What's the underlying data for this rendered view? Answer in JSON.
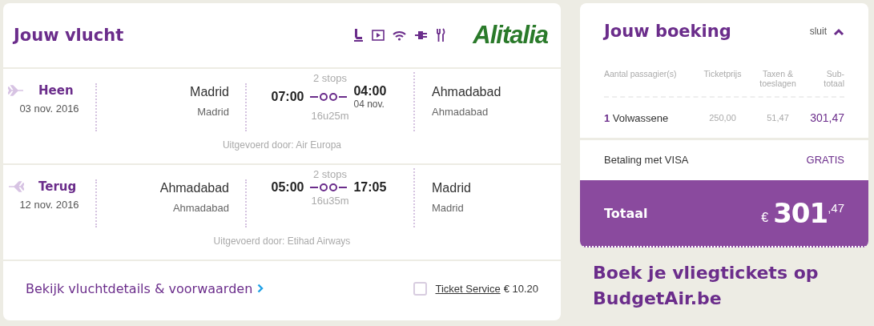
{
  "flight": {
    "title": "Jouw vlucht",
    "airline_logo": "Alitalia",
    "legs": [
      {
        "kind": "outbound",
        "label": "Heen",
        "date": "03 nov. 2016",
        "from_city": "Madrid",
        "from_airport": "Madrid",
        "depart": "07:00",
        "stops": "2 stops",
        "duration": "16u25m",
        "arrive": "04:00",
        "arrive_date": "04 nov.",
        "to_city": "Ahmadabad",
        "to_airport": "Ahmadabad",
        "operated_by": "Uitgevoerd door: Air Europa"
      },
      {
        "kind": "return",
        "label": "Terug",
        "date": "12 nov. 2016",
        "from_city": "Ahmadabad",
        "from_airport": "Ahmadabad",
        "depart": "05:00",
        "stops": "2 stops",
        "duration": "16u35m",
        "arrive": "17:05",
        "to_city": "Madrid",
        "to_airport": "Madrid",
        "operated_by": "Uitgevoerd door: Etihad Airways"
      }
    ],
    "details_link": "Bekijk vluchtdetails & voorwaarden",
    "ticket_service": {
      "label": "Ticket Service",
      "price": "€ 10.20",
      "checked": false
    }
  },
  "booking": {
    "title": "Jouw boeking",
    "toggle": "sluit",
    "expanded": true,
    "columns": [
      "Aantal passagier(s)",
      "Ticketprijs",
      "Taxen & toeslagen",
      "Sub-totaal"
    ],
    "rows": [
      {
        "count": "1",
        "type": "Volwassene",
        "ticket": "250,00",
        "taxes": "51,47",
        "subtotal": "301,47"
      }
    ],
    "payment": {
      "label": "Betaling met VISA",
      "price": "GRATIS"
    },
    "total": {
      "label": "Totaal",
      "currency": "€",
      "amount": "301",
      "cents": ",47"
    }
  },
  "promo": {
    "title": "Boek je vliegtickets op BudgetAir.be"
  }
}
